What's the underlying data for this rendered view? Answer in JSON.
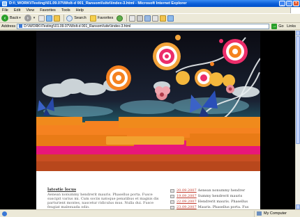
{
  "window": {
    "title": "D:\\\\_WORK\\\\Testing\\\\01.09.07\\\\Wolt-d 001_Ransom\\\\site\\\\index-3.html - Microsoft Internet Explorer"
  },
  "menu": [
    "File",
    "Edit",
    "View",
    "Favorites",
    "Tools",
    "Help"
  ],
  "toolbar": {
    "back_label": "Back",
    "search_label": "Search",
    "favorites_label": "Favorites"
  },
  "address": {
    "label": "Address",
    "value": "D:\\\\WORK\\\\Testing\\\\01.09.07\\\\Wolt-d 001_Ransom\\\\site\\\\index-3.html",
    "go_label": "Go",
    "links_label": "Links"
  },
  "page": {
    "latest_title": "latestie locus",
    "latest_text": "Aenean nonummy hendrerit mauris. Phasellus porta. Fusce suscipit varius mi. Cum sociis natoque penatibus et magnis dis parturient montes, nascetur ridiculus mus. Nulla dui. Fusce feugiat malesuada odio.",
    "news": [
      {
        "date": "20.09.2007",
        "text": "Aenean nonummy hendrer"
      },
      {
        "date": "19.09.2007",
        "text": "Summy hendrerit mauris"
      },
      {
        "date": "22.09.2007",
        "text": "Hendrerit mauris. Phasellus"
      },
      {
        "date": "23.09.2007",
        "text": "Mauris. Phasellus porta. Fus"
      }
    ]
  },
  "status": {
    "zone_label": "My Computer"
  },
  "colors": {
    "xp_blue": "#0a5ed8",
    "hero_orange": "#f58220",
    "hero_magenta": "#e8177a",
    "hero_teal": "#1f7f86"
  }
}
